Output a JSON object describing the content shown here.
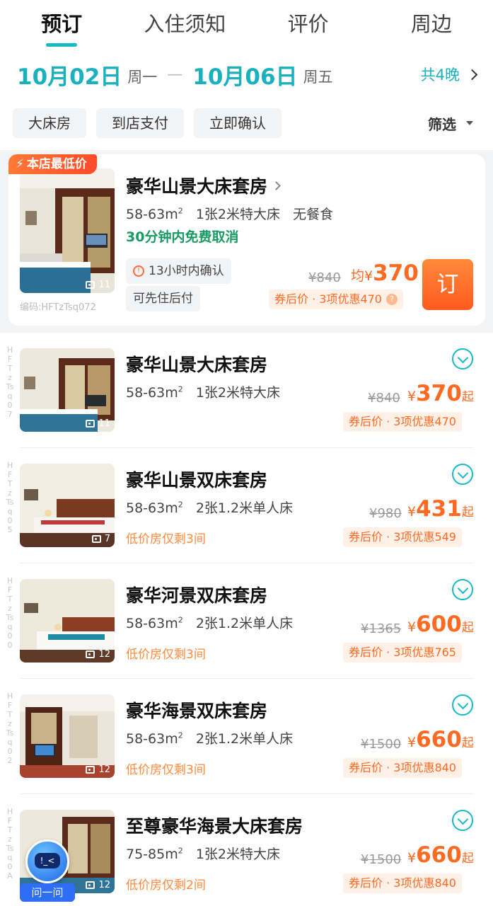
{
  "tabs": [
    {
      "label": "预订",
      "active": true
    },
    {
      "label": "入住须知",
      "active": false
    },
    {
      "label": "评价",
      "active": false
    },
    {
      "label": "周边",
      "active": false
    }
  ],
  "dates": {
    "checkin": "10月02日",
    "checkin_weekday": "周一",
    "separator": "—",
    "checkout": "10月06日",
    "checkout_weekday": "周五",
    "nights": "共4晚"
  },
  "filters": [
    "大床房",
    "到店支付",
    "立即确认"
  ],
  "filter_button": "筛选",
  "colors": {
    "accent": "#16b9c6",
    "price": "#ff6a22",
    "cancel_green": "#1a9a63"
  },
  "featured": {
    "badge": "本店最低价",
    "name": "豪华山景大床套房",
    "spec": {
      "area": "58-63m",
      "unit_sup": "2",
      "bed": "1张2米特大床",
      "meal": "无餐食"
    },
    "cancel": "30分钟内免费取消",
    "confirm_tag": "13小时内确认",
    "pay_tag": "可先住后付",
    "code": "编码:HFTzTsq072",
    "photo_count": "11",
    "old_price": "¥840",
    "avg_label": "均",
    "currency": "¥",
    "price": "370",
    "coupon": "券后价 · 3项优惠470",
    "book_label": "订"
  },
  "rooms": [
    {
      "name": "豪华山景大床套房",
      "area": "58-63m",
      "unit_sup": "2",
      "bed": "1张2米特大床",
      "old_price": "¥840",
      "currency": "¥",
      "price": "370",
      "suffix": "起",
      "coupon": "券后价 · 3项优惠470",
      "photos": "11",
      "code": "HFTzTsq07",
      "low_stock": ""
    },
    {
      "name": "豪华山景双床套房",
      "area": "58-63m",
      "unit_sup": "2",
      "bed": "2张1.2米单人床",
      "old_price": "¥980",
      "currency": "¥",
      "price": "431",
      "suffix": "起",
      "coupon": "券后价 · 3项优惠549",
      "photos": "7",
      "code": "HFTzTsq05",
      "low_stock": "低价房仅剩3间"
    },
    {
      "name": "豪华河景双床套房",
      "area": "58-63m",
      "unit_sup": "2",
      "bed": "2张1.2米单人床",
      "old_price": "¥1365",
      "currency": "¥",
      "price": "600",
      "suffix": "起",
      "coupon": "券后价 · 3项优惠765",
      "photos": "12",
      "code": "HFTzTsq00",
      "low_stock": "低价房仅剩3间"
    },
    {
      "name": "豪华海景双床套房",
      "area": "58-63m",
      "unit_sup": "2",
      "bed": "2张1.2米单人床",
      "old_price": "¥1500",
      "currency": "¥",
      "price": "660",
      "suffix": "起",
      "coupon": "券后价 · 3项优惠840",
      "photos": "12",
      "code": "HFTzTsq02",
      "low_stock": "低价房仅剩3间"
    },
    {
      "name": "至尊豪华海景大床套房",
      "area": "75-85m",
      "unit_sup": "2",
      "bed": "1张2米特大床",
      "old_price": "¥1500",
      "currency": "¥",
      "price": "660",
      "suffix": "起",
      "coupon": "券后价 · 3项优惠840",
      "photos": "12",
      "code": "HFTzTsq0A",
      "low_stock": "低价房仅剩2间"
    }
  ],
  "assistant": {
    "label": "问一问",
    "face": "!_<"
  }
}
